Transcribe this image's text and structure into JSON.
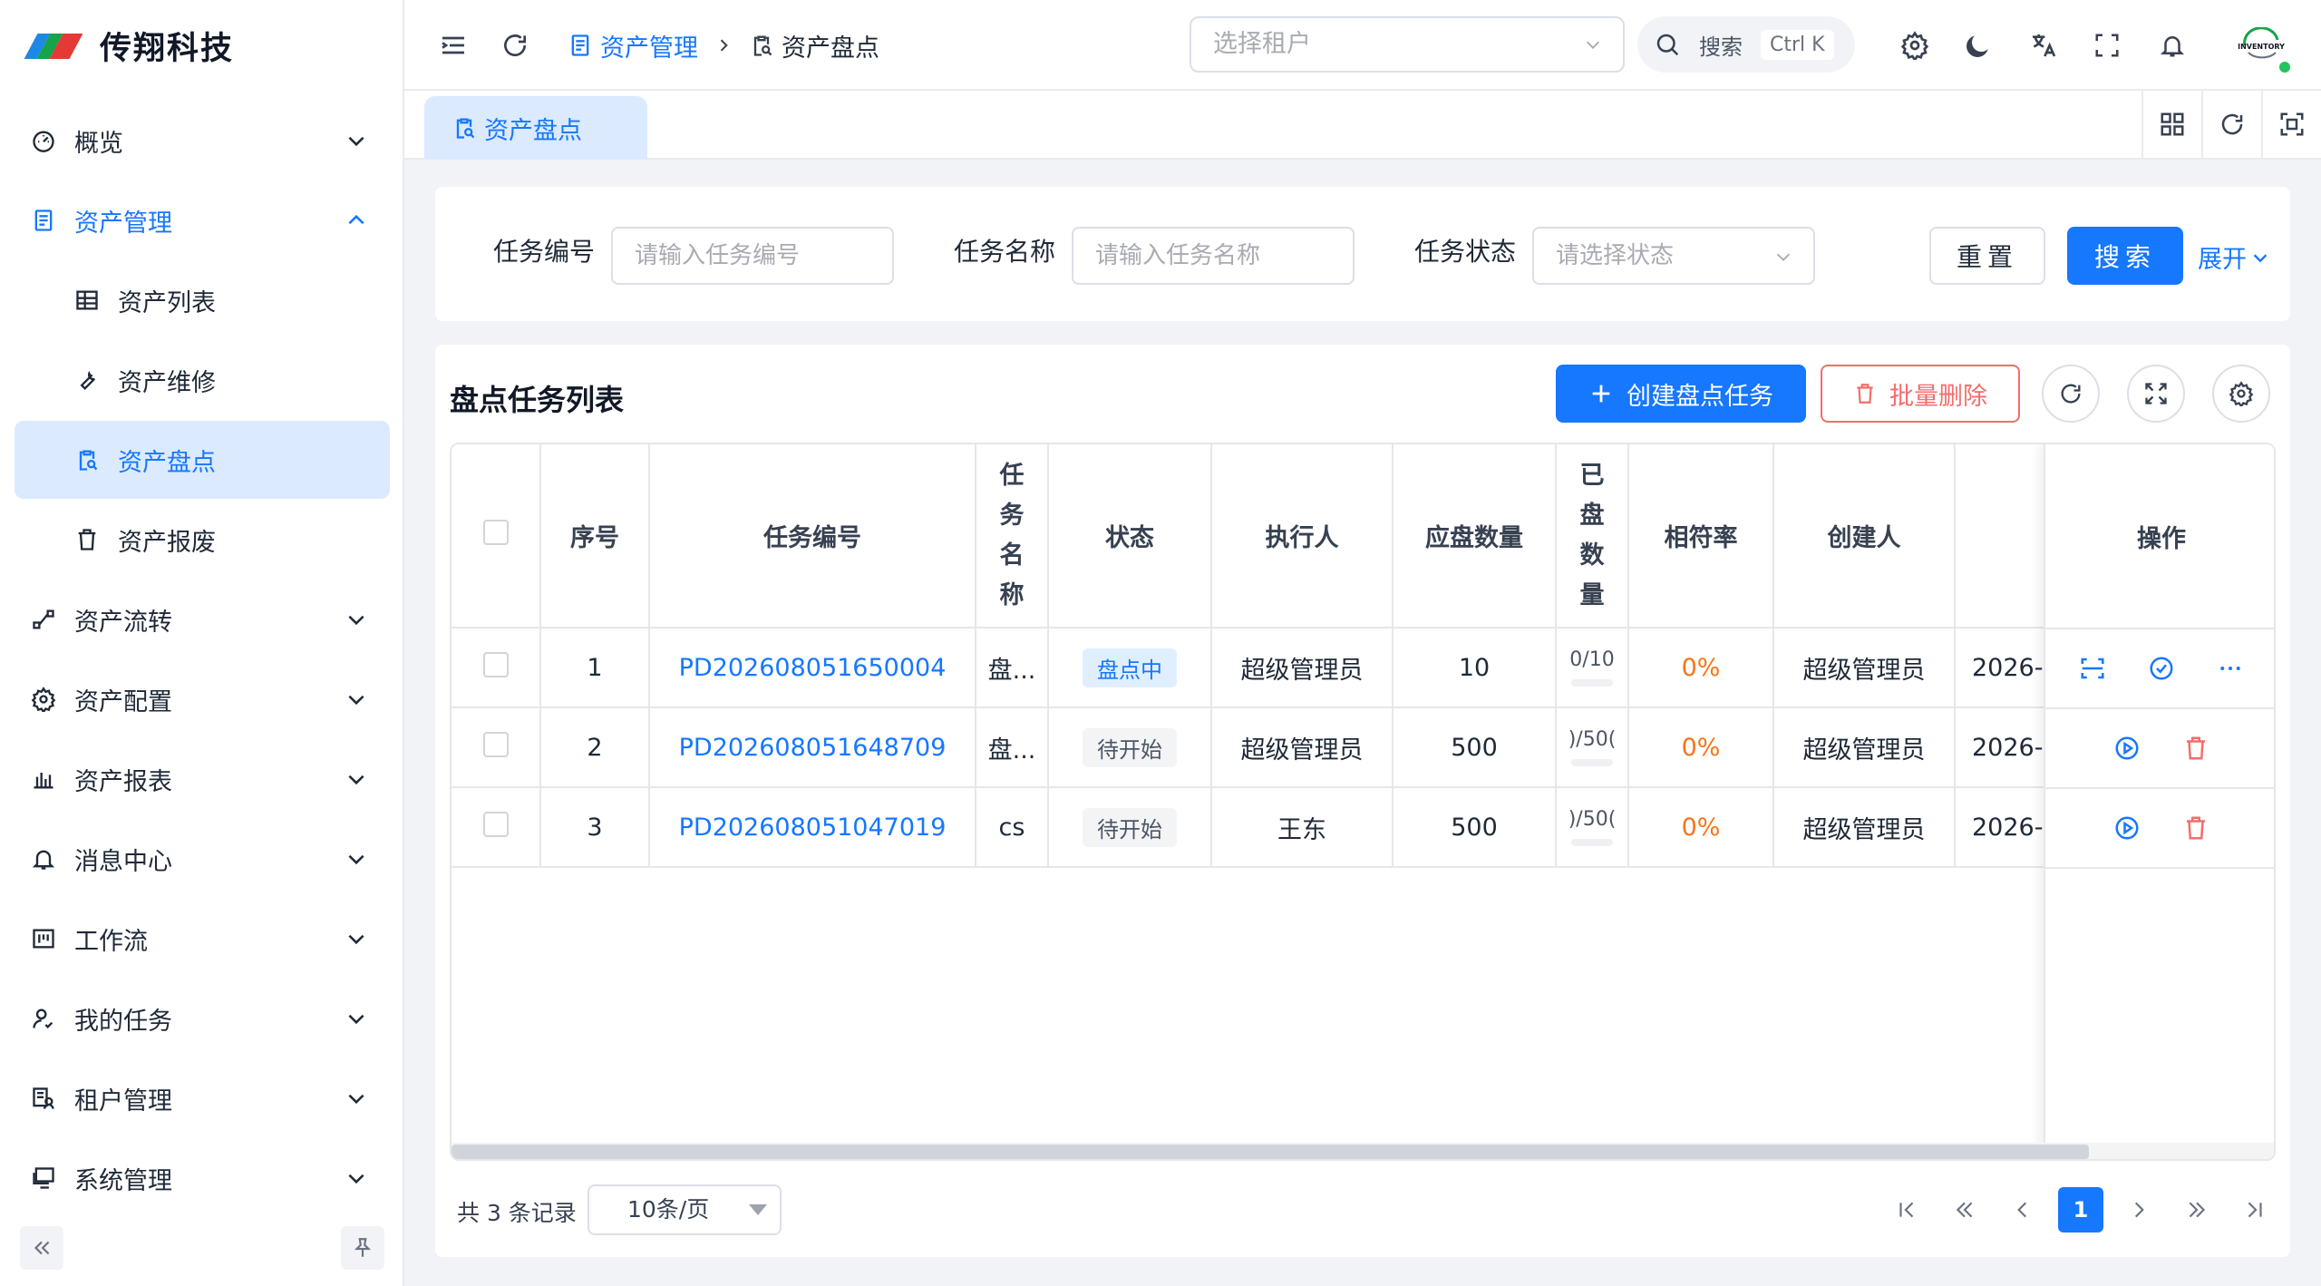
{
  "brand": {
    "name": "传翔科技"
  },
  "sidebar": {
    "items": [
      {
        "label": "概览",
        "icon": "dashboard-icon",
        "expandable": true,
        "expanded": false
      },
      {
        "label": "资产管理",
        "icon": "asset-doc-icon",
        "expandable": true,
        "expanded": true
      },
      {
        "label": "资产列表",
        "icon": "table-grid-icon",
        "sub": true
      },
      {
        "label": "资产维修",
        "icon": "wrench-icon",
        "sub": true
      },
      {
        "label": "资产盘点",
        "icon": "clipboard-search-icon",
        "sub": true,
        "selected": true
      },
      {
        "label": "资产报废",
        "icon": "trash-icon",
        "sub": true
      },
      {
        "label": "资产流转",
        "icon": "flow-icon",
        "expandable": true
      },
      {
        "label": "资产配置",
        "icon": "gear-icon",
        "expandable": true
      },
      {
        "label": "资产报表",
        "icon": "bar-chart-icon",
        "expandable": true
      },
      {
        "label": "消息中心",
        "icon": "bell-icon",
        "expandable": true
      },
      {
        "label": "工作流",
        "icon": "kanban-icon",
        "expandable": true
      },
      {
        "label": "我的任务",
        "icon": "user-check-icon",
        "expandable": true
      },
      {
        "label": "租户管理",
        "icon": "tenant-icon",
        "expandable": true
      },
      {
        "label": "系统管理",
        "icon": "monitor-icon",
        "expandable": true
      }
    ]
  },
  "header": {
    "breadcrumb": [
      {
        "label": "资产管理",
        "icon": "asset-doc-icon"
      },
      {
        "label": "资产盘点",
        "icon": "clipboard-search-icon"
      }
    ],
    "tenant_placeholder": "选择租户",
    "search_label": "搜索",
    "search_shortcut": "Ctrl K",
    "avatar_text": "INVENTORY"
  },
  "tabs": [
    {
      "label": "资产盘点",
      "icon": "clipboard-search-icon"
    }
  ],
  "filter": {
    "task_no_label": "任务编号",
    "task_no_placeholder": "请输入任务编号",
    "task_name_label": "任务名称",
    "task_name_placeholder": "请输入任务名称",
    "status_label": "任务状态",
    "status_placeholder": "请选择状态",
    "reset_label": "重置",
    "search_label": "搜索",
    "expand_label": "展开"
  },
  "panel": {
    "title": "盘点任务列表",
    "create_label": "创建盘点任务",
    "batch_delete_label": "批量删除"
  },
  "table": {
    "columns": [
      "序号",
      "任务编号",
      "任务名称",
      "状态",
      "执行人",
      "应盘数量",
      "已盘数量",
      "相符率",
      "创建人",
      "",
      "操作"
    ],
    "rows": [
      {
        "index": "1",
        "task_no": "PD202608051650004",
        "task_name": "盘...",
        "status": "盘点中",
        "status_type": "blue",
        "executor": "超级管理员",
        "expected": "10",
        "counted": "0/10",
        "rate": "0%",
        "creator": "超级管理员",
        "created": "2026-",
        "ops": [
          "scan-icon",
          "check-circle-icon",
          "more-icon"
        ]
      },
      {
        "index": "2",
        "task_no": "PD202608051648709",
        "task_name": "盘...",
        "status": "待开始",
        "status_type": "gray",
        "executor": "超级管理员",
        "expected": "500",
        "counted": ")/50(",
        "rate": "0%",
        "creator": "超级管理员",
        "created": "2026-",
        "ops": [
          "play-circle-icon",
          "delete-icon"
        ]
      },
      {
        "index": "3",
        "task_no": "PD202608051047019",
        "task_name": "cs",
        "status": "待开始",
        "status_type": "gray",
        "executor": "王东",
        "expected": "500",
        "counted": ")/50(",
        "rate": "0%",
        "creator": "超级管理员",
        "created": "2026-",
        "ops": [
          "play-circle-icon",
          "delete-icon"
        ]
      }
    ]
  },
  "pagination": {
    "total_text": "共 3 条记录",
    "page_size": "10条/页",
    "current_page": "1"
  },
  "colors": {
    "primary": "#1677ff",
    "danger": "#f56c6c",
    "warning": "#f97316",
    "selected_bg": "#dbeafe"
  }
}
